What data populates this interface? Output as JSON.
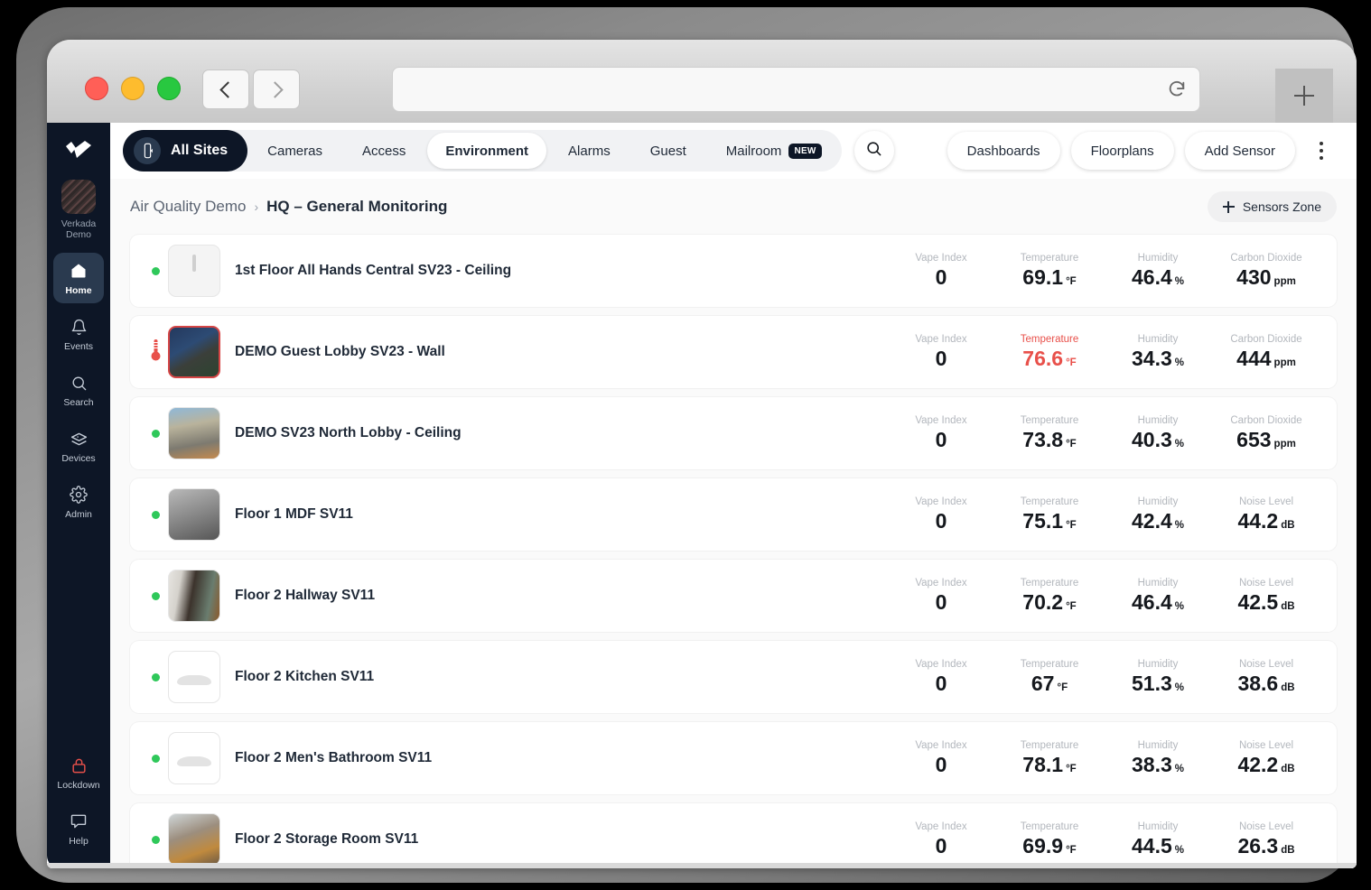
{
  "browser": {
    "url_value": "",
    "url_placeholder": "",
    "reload_icon": "reload-icon",
    "back_icon": "back-chevron-icon",
    "forward_icon": "forward-chevron-icon",
    "new_tab_icon": "plus-icon"
  },
  "sidebar": {
    "logo_icon": "verkada-logo-icon",
    "org_name": "Verkada\nDemo",
    "org_line1": "Verkada",
    "org_line2": "Demo",
    "items": [
      {
        "label": "Home",
        "icon": "home-icon",
        "active": true
      },
      {
        "label": "Events",
        "icon": "bell-icon",
        "active": false
      },
      {
        "label": "Search",
        "icon": "search-icon",
        "active": false
      },
      {
        "label": "Devices",
        "icon": "devices-icon",
        "active": false
      },
      {
        "label": "Admin",
        "icon": "gear-icon",
        "active": false
      }
    ],
    "bottom_items": [
      {
        "label": "Lockdown",
        "icon": "lock-icon",
        "color": "#e8504a"
      },
      {
        "label": "Help",
        "icon": "chat-bubble-icon",
        "color": "#c3cbd6"
      }
    ]
  },
  "topnav": {
    "all_sites_label": "All Sites",
    "all_sites_icon": "sites-icon",
    "tabs": [
      {
        "label": "Cameras",
        "selected": false,
        "badge": null
      },
      {
        "label": "Access",
        "selected": false,
        "badge": null
      },
      {
        "label": "Environment",
        "selected": true,
        "badge": null
      },
      {
        "label": "Alarms",
        "selected": false,
        "badge": null
      },
      {
        "label": "Guest",
        "selected": false,
        "badge": null
      },
      {
        "label": "Mailroom",
        "selected": false,
        "badge": "NEW"
      }
    ],
    "search_icon": "search-icon",
    "actions": [
      {
        "label": "Dashboards"
      },
      {
        "label": "Floorplans"
      },
      {
        "label": "Add Sensor"
      }
    ],
    "kebab_icon": "more-vertical-icon"
  },
  "breadcrumb": {
    "root": "Air Quality Demo",
    "separator": "›",
    "leaf": "HQ – General Monitoring"
  },
  "zone_button": {
    "label": "Sensors Zone",
    "icon": "plus-icon"
  },
  "colors": {
    "accent_dark": "#0d1626",
    "status_ok": "#2fc85a",
    "status_alert": "#e8504a",
    "page_bg": "#fafafa"
  },
  "sensors": [
    {
      "name": "1st Floor All Hands Central SV23 - Ceiling",
      "status": "ok",
      "status_icon": "status-dot-icon",
      "thumb": "sensor-device-photo",
      "metrics": [
        {
          "label": "Vape Index",
          "value": "0",
          "unit": "",
          "alert": false
        },
        {
          "label": "Temperature",
          "value": "69.1",
          "unit": "°F",
          "alert": false
        },
        {
          "label": "Humidity",
          "value": "46.4",
          "unit": "%",
          "alert": false
        },
        {
          "label": "Carbon Dioxide",
          "value": "430",
          "unit": "ppm",
          "alert": false
        }
      ]
    },
    {
      "name": "DEMO Guest Lobby SV23 - Wall",
      "status": "alert",
      "status_icon": "thermometer-icon",
      "thumb": "lobby-camera-photo",
      "metrics": [
        {
          "label": "Vape Index",
          "value": "0",
          "unit": "",
          "alert": false
        },
        {
          "label": "Temperature",
          "value": "76.6",
          "unit": "°F",
          "alert": true
        },
        {
          "label": "Humidity",
          "value": "34.3",
          "unit": "%",
          "alert": false
        },
        {
          "label": "Carbon Dioxide",
          "value": "444",
          "unit": "ppm",
          "alert": false
        }
      ]
    },
    {
      "name": "DEMO SV23 North Lobby - Ceiling",
      "status": "ok",
      "status_icon": "status-dot-icon",
      "thumb": "north-lobby-camera-photo",
      "metrics": [
        {
          "label": "Vape Index",
          "value": "0",
          "unit": "",
          "alert": false
        },
        {
          "label": "Temperature",
          "value": "73.8",
          "unit": "°F",
          "alert": false
        },
        {
          "label": "Humidity",
          "value": "40.3",
          "unit": "%",
          "alert": false
        },
        {
          "label": "Carbon Dioxide",
          "value": "653",
          "unit": "ppm",
          "alert": false
        }
      ]
    },
    {
      "name": "Floor 1 MDF SV11",
      "status": "ok",
      "status_icon": "status-dot-icon",
      "thumb": "mdf-room-photo",
      "metrics": [
        {
          "label": "Vape Index",
          "value": "0",
          "unit": "",
          "alert": false
        },
        {
          "label": "Temperature",
          "value": "75.1",
          "unit": "°F",
          "alert": false
        },
        {
          "label": "Humidity",
          "value": "42.4",
          "unit": "%",
          "alert": false
        },
        {
          "label": "Noise Level",
          "value": "44.2",
          "unit": "dB",
          "alert": false
        }
      ]
    },
    {
      "name": "Floor 2 Hallway SV11",
      "status": "ok",
      "status_icon": "status-dot-icon",
      "thumb": "hallway-photo",
      "metrics": [
        {
          "label": "Vape Index",
          "value": "0",
          "unit": "",
          "alert": false
        },
        {
          "label": "Temperature",
          "value": "70.2",
          "unit": "°F",
          "alert": false
        },
        {
          "label": "Humidity",
          "value": "46.4",
          "unit": "%",
          "alert": false
        },
        {
          "label": "Noise Level",
          "value": "42.5",
          "unit": "dB",
          "alert": false
        }
      ]
    },
    {
      "name": "Floor 2 Kitchen SV11",
      "status": "ok",
      "status_icon": "status-dot-icon",
      "thumb": "sv11-device-photo",
      "metrics": [
        {
          "label": "Vape Index",
          "value": "0",
          "unit": "",
          "alert": false
        },
        {
          "label": "Temperature",
          "value": "67",
          "unit": "°F",
          "alert": false
        },
        {
          "label": "Humidity",
          "value": "51.3",
          "unit": "%",
          "alert": false
        },
        {
          "label": "Noise Level",
          "value": "38.6",
          "unit": "dB",
          "alert": false
        }
      ]
    },
    {
      "name": "Floor 2 Men's Bathroom SV11",
      "status": "ok",
      "status_icon": "status-dot-icon",
      "thumb": "sv11-device-photo",
      "metrics": [
        {
          "label": "Vape Index",
          "value": "0",
          "unit": "",
          "alert": false
        },
        {
          "label": "Temperature",
          "value": "78.1",
          "unit": "°F",
          "alert": false
        },
        {
          "label": "Humidity",
          "value": "38.3",
          "unit": "%",
          "alert": false
        },
        {
          "label": "Noise Level",
          "value": "42.2",
          "unit": "dB",
          "alert": false
        }
      ]
    },
    {
      "name": "Floor 2 Storage Room SV11",
      "status": "ok",
      "status_icon": "status-dot-icon",
      "thumb": "storage-room-photo",
      "metrics": [
        {
          "label": "Vape Index",
          "value": "0",
          "unit": "",
          "alert": false
        },
        {
          "label": "Temperature",
          "value": "69.9",
          "unit": "°F",
          "alert": false
        },
        {
          "label": "Humidity",
          "value": "44.5",
          "unit": "%",
          "alert": false
        },
        {
          "label": "Noise Level",
          "value": "26.3",
          "unit": "dB",
          "alert": false
        }
      ]
    }
  ]
}
